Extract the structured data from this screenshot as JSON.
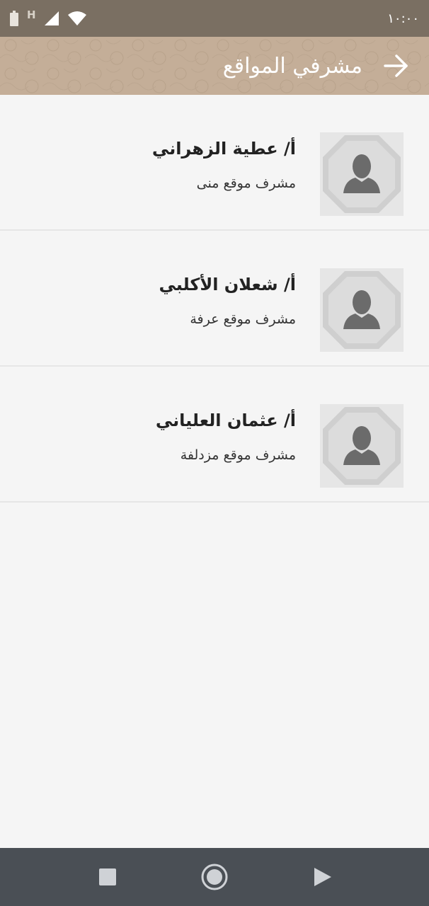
{
  "status_bar": {
    "time": "١٠:٠٠",
    "network_letter": "H"
  },
  "app_bar": {
    "title": "مشرفي المواقع"
  },
  "supervisors": [
    {
      "name": "أ/ عطية الزهراني",
      "role": "مشرف موقع منى"
    },
    {
      "name": "أ/ شعلان الأكلبي",
      "role": "مشرف موقع عرفة"
    },
    {
      "name": "أ/ عثمان العلياني",
      "role": "مشرف موقع مزدلفة"
    }
  ],
  "colors": {
    "status_bar": "#7a6f62",
    "app_bar": "#c4ae98",
    "background": "#f5f5f5",
    "nav_bar": "#4a4f55"
  },
  "icons": {
    "back": "arrow-right-icon",
    "avatar": "person-silhouette-icon",
    "nav_stop": "square-icon",
    "nav_home": "circle-icon",
    "nav_play": "triangle-icon"
  }
}
